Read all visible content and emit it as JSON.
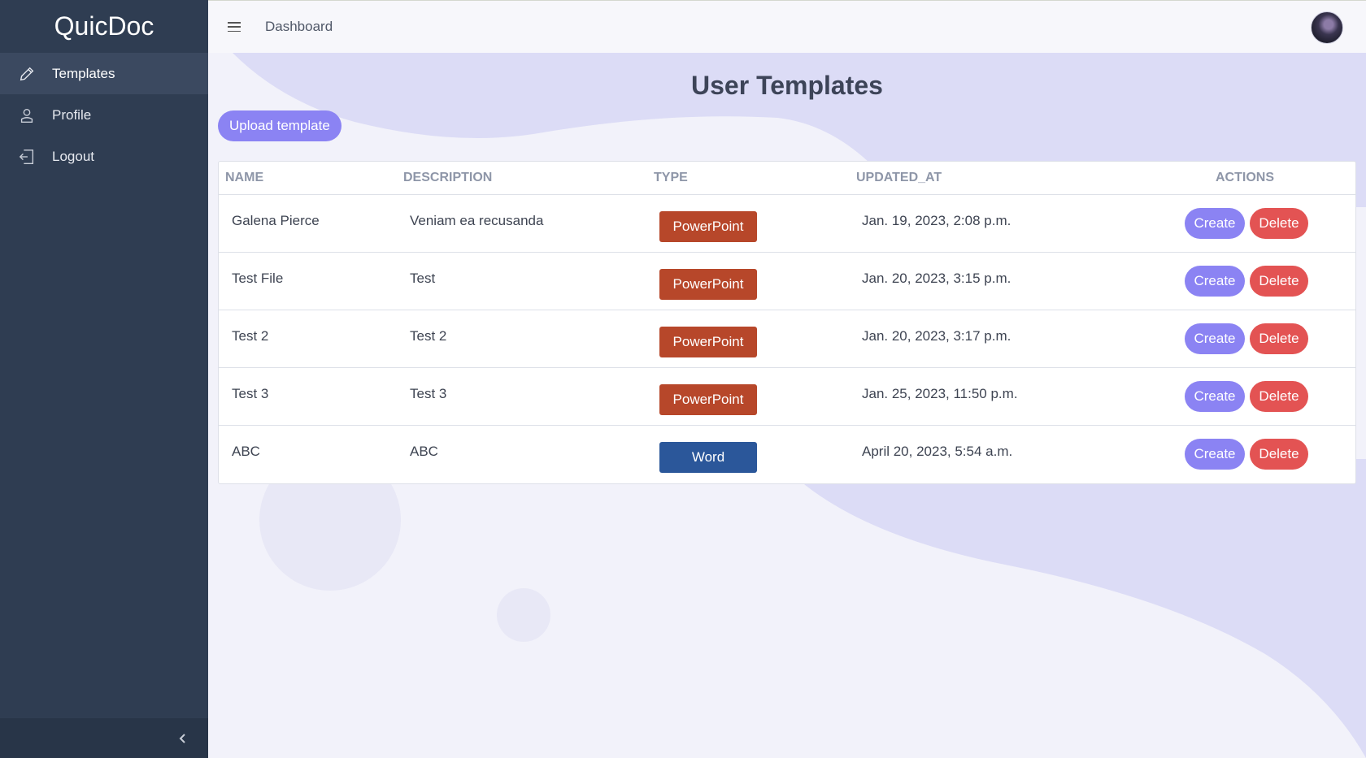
{
  "sidebar": {
    "brand": "QuicDoc",
    "items": [
      {
        "label": "Templates",
        "icon": "pencil-icon",
        "active": true
      },
      {
        "label": "Profile",
        "icon": "user-icon",
        "active": false
      },
      {
        "label": "Logout",
        "icon": "logout-icon",
        "active": false
      }
    ],
    "collapse_icon": "chevron-left-icon"
  },
  "topbar": {
    "breadcrumb": "Dashboard",
    "menu_icon": "hamburger-icon"
  },
  "main": {
    "title": "User Templates",
    "upload_label": "Upload template",
    "table": {
      "headers": [
        "NAME",
        "DESCRIPTION",
        "TYPE",
        "UPDATED_AT",
        "ACTIONS"
      ],
      "rows": [
        {
          "name": "Galena Pierce",
          "description": "Veniam ea recusanda",
          "type": "PowerPoint",
          "updated_at": "Jan. 19, 2023, 2:08 p.m."
        },
        {
          "name": "Test File",
          "description": "Test",
          "type": "PowerPoint",
          "updated_at": "Jan. 20, 2023, 3:15 p.m."
        },
        {
          "name": "Test 2",
          "description": "Test 2",
          "type": "PowerPoint",
          "updated_at": "Jan. 20, 2023, 3:17 p.m."
        },
        {
          "name": "Test 3",
          "description": "Test 3",
          "type": "PowerPoint",
          "updated_at": "Jan. 25, 2023, 11:50 p.m."
        },
        {
          "name": "ABC",
          "description": "ABC",
          "type": "Word",
          "updated_at": "April 20, 2023, 5:54 a.m."
        }
      ],
      "create_label": "Create",
      "delete_label": "Delete"
    }
  },
  "colors": {
    "sidebar_bg": "#2f3d52",
    "accent": "#8b83f3",
    "danger": "#e35353",
    "powerpoint": "#b7472a",
    "word": "#2b579a"
  }
}
